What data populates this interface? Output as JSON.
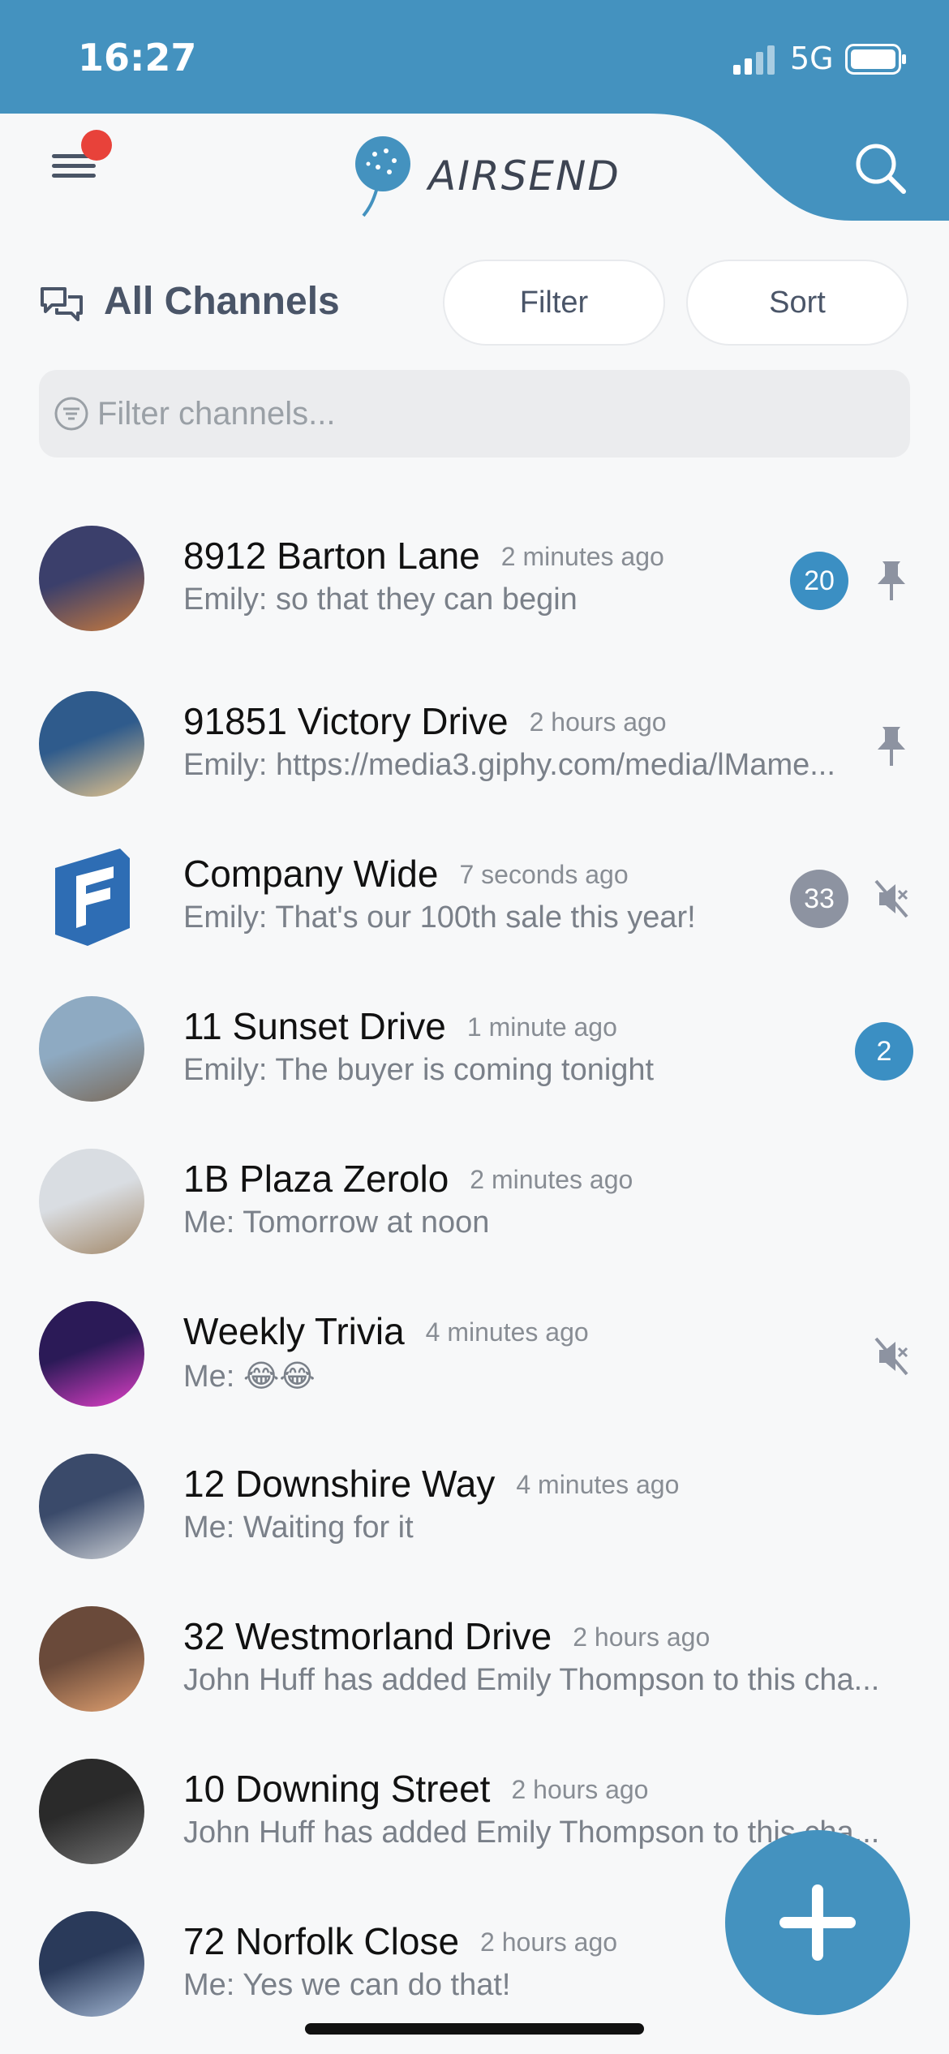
{
  "status": {
    "time": "16:27",
    "network": "5G"
  },
  "header": {
    "logo_text": "AIRSEND",
    "has_notification": true
  },
  "toolbar": {
    "title": "All Channels",
    "filter_label": "Filter",
    "sort_label": "Sort"
  },
  "search": {
    "placeholder": "Filter channels..."
  },
  "colors": {
    "brand": "#4492bf",
    "badge_blue": "#3b8fc3",
    "badge_gray": "#8d93a1",
    "notification": "#e8423a"
  },
  "channels": [
    {
      "name": "8912 Barton Lane",
      "time": "2 minutes ago",
      "message": "Emily: so that they can begin",
      "badge": "20",
      "badge_style": "blue",
      "trailing_icon": "pin-icon"
    },
    {
      "name": "91851 Victory Drive",
      "time": "2 hours ago",
      "message": "Emily: https://media3.giphy.com/media/lMame...",
      "badge": "",
      "badge_style": "",
      "trailing_icon": "pin-icon"
    },
    {
      "name": "Company Wide",
      "time": "7 seconds ago",
      "message": "Emily: That's our 100th sale this year!",
      "badge": "33",
      "badge_style": "gray",
      "trailing_icon": "muted-icon"
    },
    {
      "name": "11 Sunset Drive",
      "time": "1 minute ago",
      "message": "Emily: The buyer is coming tonight",
      "badge": "2",
      "badge_style": "blue",
      "trailing_icon": ""
    },
    {
      "name": "1B Plaza Zerolo",
      "time": "2 minutes ago",
      "message": "Me: Tomorrow at noon",
      "badge": "",
      "badge_style": "",
      "trailing_icon": ""
    },
    {
      "name": "Weekly Trivia",
      "time": "4 minutes ago",
      "message": "Me: 😂😂",
      "badge": "",
      "badge_style": "",
      "trailing_icon": "muted-icon"
    },
    {
      "name": "12 Downshire Way",
      "time": "4 minutes ago",
      "message": "Me: Waiting for it",
      "badge": "",
      "badge_style": "",
      "trailing_icon": ""
    },
    {
      "name": "32 Westmorland Drive",
      "time": "2 hours ago",
      "message": "John Huff has added Emily Thompson to this cha...",
      "badge": "",
      "badge_style": "",
      "trailing_icon": ""
    },
    {
      "name": "10 Downing Street",
      "time": "2 hours ago",
      "message": "John Huff has added Emily Thompson to this cha...",
      "badge": "",
      "badge_style": "",
      "trailing_icon": ""
    },
    {
      "name": "72 Norfolk Close",
      "time": "2 hours ago",
      "message": "Me: Yes we can do that!",
      "badge": "",
      "badge_style": "",
      "trailing_icon": ""
    }
  ],
  "fab": {
    "icon": "plus-icon"
  }
}
